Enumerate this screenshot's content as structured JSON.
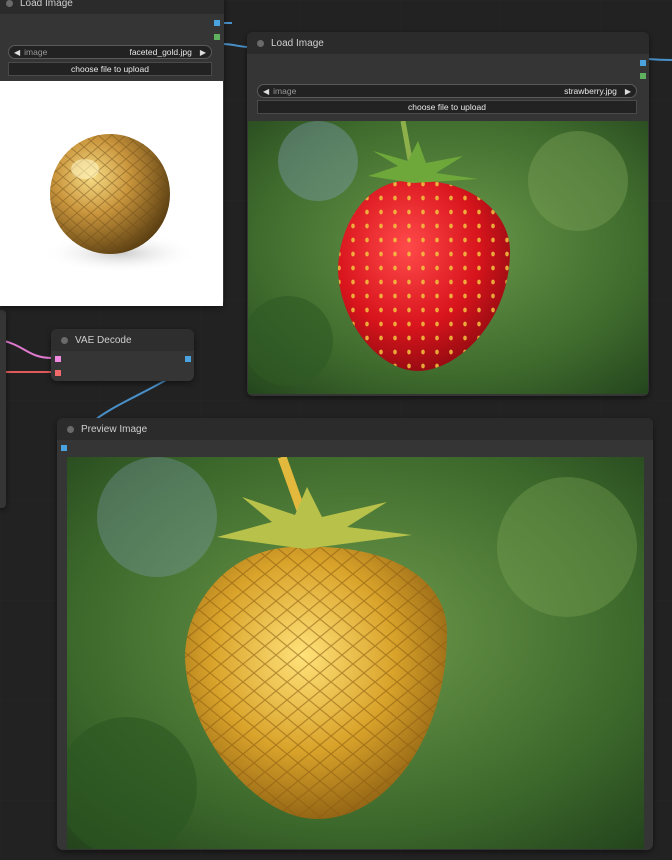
{
  "nodes": {
    "load_image_1": {
      "title": "Load Image",
      "widget_label": "image",
      "widget_value": "faceted_gold.jpg",
      "upload_label": "choose file to upload"
    },
    "load_image_2": {
      "title": "Load Image",
      "widget_label": "image",
      "widget_value": "strawberry.jpg",
      "upload_label": "choose file to upload"
    },
    "vae_decode": {
      "title": "VAE Decode"
    },
    "preview_image": {
      "title": "Preview Image"
    }
  },
  "colors": {
    "background": "#222222",
    "node_body": "#353535",
    "node_title": "#2b2b2b",
    "link_image": "#4a90c8",
    "link_latent": "#e07ad0",
    "link_vae": "#e05a5a",
    "slot_image": "#4aa3df",
    "slot_mask": "#5fb05f",
    "slot_latent": "#f08ae0",
    "slot_vae": "#f06a6a"
  },
  "icons": {
    "combo_prev": "◀",
    "combo_next": "▶"
  }
}
